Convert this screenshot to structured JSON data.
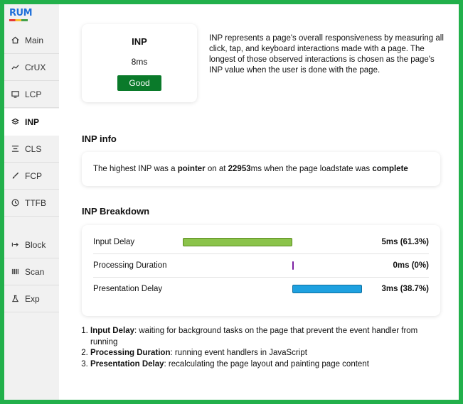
{
  "logo": {
    "text": "RUM"
  },
  "sidebar": {
    "items": [
      {
        "label": "Main",
        "icon": "home-icon"
      },
      {
        "label": "CrUX",
        "icon": "trend-icon"
      },
      {
        "label": "LCP",
        "icon": "monitor-icon"
      },
      {
        "label": "INP",
        "icon": "layers-icon",
        "active": true
      },
      {
        "label": "CLS",
        "icon": "align-icon"
      },
      {
        "label": "FCP",
        "icon": "brush-icon"
      },
      {
        "label": "TTFB",
        "icon": "clock-icon"
      },
      {
        "label": "Block",
        "icon": "arrow-bar-icon"
      },
      {
        "label": "Scan",
        "icon": "barcode-icon"
      },
      {
        "label": "Exp",
        "icon": "flask-icon"
      }
    ]
  },
  "metric": {
    "title": "INP",
    "value": "8ms",
    "rating": "Good",
    "rating_color": "#0a7a2a"
  },
  "description": "INP represents a page's overall responsiveness by measuring all click, tap, and keyboard interactions made with a page. The longest of those observed interactions is chosen as the page's INP value when the user is done with the page.",
  "inp_info": {
    "heading": "INP info",
    "prefix": "The highest INP was a ",
    "interaction_type": "pointer",
    "mid": " on at ",
    "time": "22953",
    "time_unit": "ms when the page loadstate was ",
    "loadstate": "complete"
  },
  "breakdown": {
    "heading": "INP Breakdown",
    "rows": [
      {
        "label": "Input Delay",
        "value": "5ms (61.3%)",
        "start_pct": 0,
        "width_pct": 61.3,
        "color": "#8bc34a",
        "border": "#5a8a1f"
      },
      {
        "label": "Processing Duration",
        "value": "0ms (0%)",
        "start_pct": 61.3,
        "width_pct": 0,
        "color": "#7b1fa2",
        "border": "#4a148c"
      },
      {
        "label": "Presentation Delay",
        "value": "3ms (38.7%)",
        "start_pct": 61.3,
        "width_pct": 38.7,
        "color": "#1ea1e0",
        "border": "#0f6f9f"
      }
    ]
  },
  "notes": [
    {
      "term": "Input Delay",
      "text": ": waiting for background tasks on the page that prevent the event handler from running"
    },
    {
      "term": "Processing Duration",
      "text": ": running event handlers in JavaScript"
    },
    {
      "term": "Presentation Delay",
      "text": ": recalculating the page layout and painting page content"
    }
  ]
}
